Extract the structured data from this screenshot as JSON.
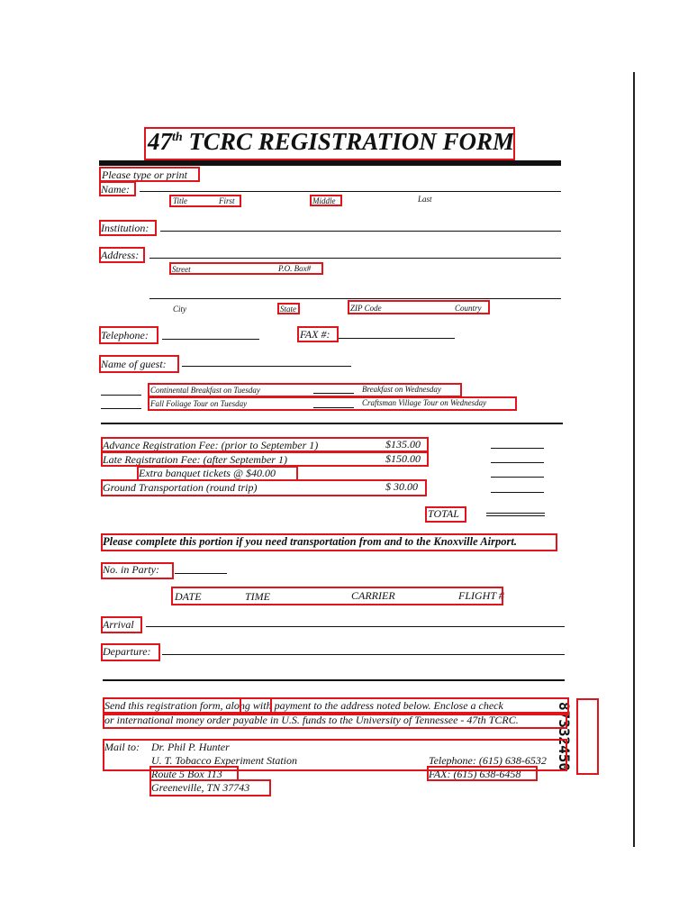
{
  "form": {
    "title_num": "47",
    "title_sup": "th",
    "title_rest": "TCRC REGISTRATION FORM",
    "please_type": "Please type or print",
    "name_label": "Name:",
    "name_fields": {
      "title": "Title",
      "first": "First",
      "middle": "Middle",
      "last": "Last"
    },
    "institution_label": "Institution:",
    "address_label": "Address:",
    "street": "Street",
    "po_box": "P.O. Box#",
    "city": "City",
    "state": "State",
    "zip": "ZIP Code",
    "country": "Country",
    "telephone_label": "Telephone:",
    "fax_label": "FAX #:",
    "guest_label": "Name of guest:",
    "events": [
      "Continental Breakfast on Tuesday",
      "Breakfast on Wednesday",
      "Fall Foliage Tour on Tuesday",
      "Craftsman Village Tour on Wednesday"
    ],
    "fees": [
      {
        "label": "Advance Registration Fee:  (prior to September 1)",
        "amount": "$135.00"
      },
      {
        "label": "Late Registration Fee:  (after September 1)",
        "amount": "$150.00"
      },
      {
        "label": "Extra banquet tickets @ $40.00",
        "amount": ""
      },
      {
        "label": "Ground Transportation (round trip)",
        "amount": "$ 30.00"
      }
    ],
    "total_label": "TOTAL",
    "transport_note": "Please complete this portion if you need transportation from and to the Knoxville Airport.",
    "party_label": "No. in Party:",
    "travel_headers": {
      "date": "DATE",
      "time": "TIME",
      "carrier": "CARRIER",
      "flight": "FLIGHT #"
    },
    "arrival_label": "Arrival",
    "departure_label": "Departure:",
    "send_line1": "Send this registration form, along with payment to the address noted below.  Enclose a check",
    "send_line2": "or international money order payable in U.S. funds to the University of Tennessee - 47th TCRC.",
    "mail_to": "Mail to:",
    "mail_lines": [
      "Dr. Phil P. Hunter",
      "U. T. Tobacco Experiment Station",
      "Route 5 Box 113",
      "Greeneville, TN  37743"
    ],
    "telephone": "Telephone: (615) 638-6532",
    "fax": "FAX: (615) 638-6458",
    "doc_id": "87332450"
  }
}
